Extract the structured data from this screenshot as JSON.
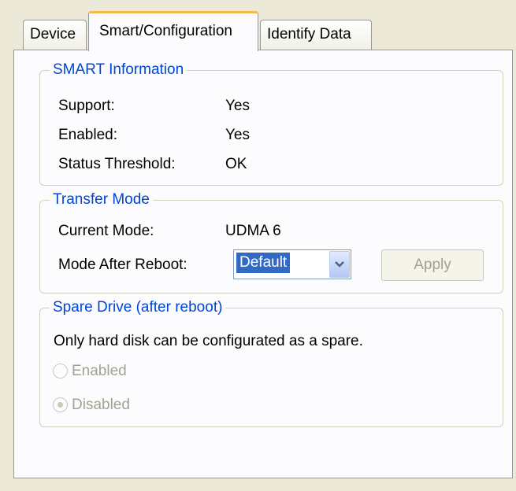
{
  "tabs": [
    {
      "label": "Device"
    },
    {
      "label": "Smart/Configuration"
    },
    {
      "label": "Identify Data"
    }
  ],
  "smart": {
    "title": "SMART Information",
    "rows": [
      {
        "label": "Support:",
        "value": "Yes"
      },
      {
        "label": "Enabled:",
        "value": "Yes"
      },
      {
        "label": "Status Threshold:",
        "value": "OK"
      }
    ]
  },
  "transfer": {
    "title": "Transfer Mode",
    "current_label": "Current Mode:",
    "current_value": "UDMA 6",
    "reboot_label": "Mode After Reboot:",
    "reboot_value": "Default",
    "apply_label": "Apply"
  },
  "spare": {
    "title": "Spare Drive (after reboot)",
    "note": "Only hard disk can be configurated as a spare.",
    "options": [
      {
        "label": "Enabled",
        "selected": false
      },
      {
        "label": "Disabled",
        "selected": true
      }
    ]
  },
  "colors": {
    "group_title": "#0046d5",
    "tab_highlight": "#f7b64a",
    "selection": "#316ac5",
    "disabled_text": "#a1a192"
  },
  "icons": {
    "dropdown": "chevron-down-icon"
  }
}
